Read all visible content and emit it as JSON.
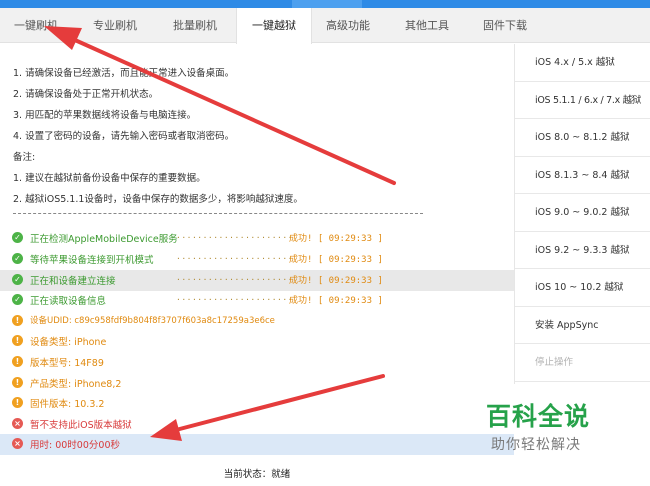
{
  "tabs": [
    {
      "label": "一键刷机",
      "active": false
    },
    {
      "label": "专业刷机",
      "active": false
    },
    {
      "label": "批量刷机",
      "active": false
    },
    {
      "label": "一键越狱",
      "active": true
    },
    {
      "label": "高级功能",
      "active": false
    },
    {
      "label": "其他工具",
      "active": false
    },
    {
      "label": "固件下载",
      "active": false
    }
  ],
  "instructions": {
    "steps": [
      "1. 请确保设备已经激活，而且能正常进入设备桌面。",
      "2. 请确保设备处于正常开机状态。",
      "3. 用匹配的苹果数据线将设备与电脑连接。",
      "4. 设置了密码的设备，请先输入密码或者取消密码。"
    ],
    "note_title": "备注:",
    "notes": [
      "1. 建议在越狱前备份设备中保存的重要数据。",
      "2. 越狱iOS5.1.1设备时，设备中保存的数据多少，将影响越狱速度。"
    ]
  },
  "log": [
    {
      "status": "ok",
      "text": "正在检测AppleMobileDevice服务",
      "dots": "......................",
      "result": "成功! [ 09:29:33 ]"
    },
    {
      "status": "ok",
      "text": "等待苹果设备连接到开机模式",
      "dots": "......................",
      "result": "成功! [ 09:29:33 ]"
    },
    {
      "status": "ok",
      "text": "正在和设备建立连接",
      "dots": "......................",
      "result": "成功! [ 09:29:33 ]"
    },
    {
      "status": "ok",
      "text": "正在读取设备信息",
      "dots": "......................",
      "result": "成功! [ 09:29:33 ]"
    },
    {
      "status": "warn",
      "text": "设备UDID: c89c958fdf9b804f8f3707f603a8c17259a3e6ce"
    },
    {
      "status": "warn",
      "text": "设备类型: iPhone"
    },
    {
      "status": "warn",
      "text": "版本型号: 14F89"
    },
    {
      "status": "warn",
      "text": "产品类型: iPhone8,2"
    },
    {
      "status": "warn",
      "text": "固件版本: 10.3.2"
    },
    {
      "status": "err",
      "text": "暂不支持此iOS版本越狱"
    },
    {
      "status": "err",
      "text": "用时: 00时00分00秒"
    }
  ],
  "status_bar": "当前状态：就绪",
  "sidebar": {
    "items": [
      {
        "label": "iOS 4.x / 5.x 越狱"
      },
      {
        "label": "iOS 5.1.1 / 6.x / 7.x 越狱"
      },
      {
        "label": "iOS 8.0 ~ 8.1.2 越狱"
      },
      {
        "label": "iOS 8.1.3 ~ 8.4 越狱"
      },
      {
        "label": "iOS 9.0 ~ 9.0.2 越狱"
      },
      {
        "label": "iOS 9.2 ~ 9.3.3 越狱"
      },
      {
        "label": "iOS 10 ~ 10.2 越狱"
      },
      {
        "label": "安装 AppSync"
      },
      {
        "label": "停止操作"
      }
    ]
  },
  "watermark": {
    "title": "百科全说",
    "subtitle": "助你轻松解决"
  },
  "colors": {
    "ok": "#4db347",
    "warn": "#f0a020",
    "err": "#e55a55",
    "arrow": "#e53c3c",
    "brand_green": "#26a24a"
  }
}
